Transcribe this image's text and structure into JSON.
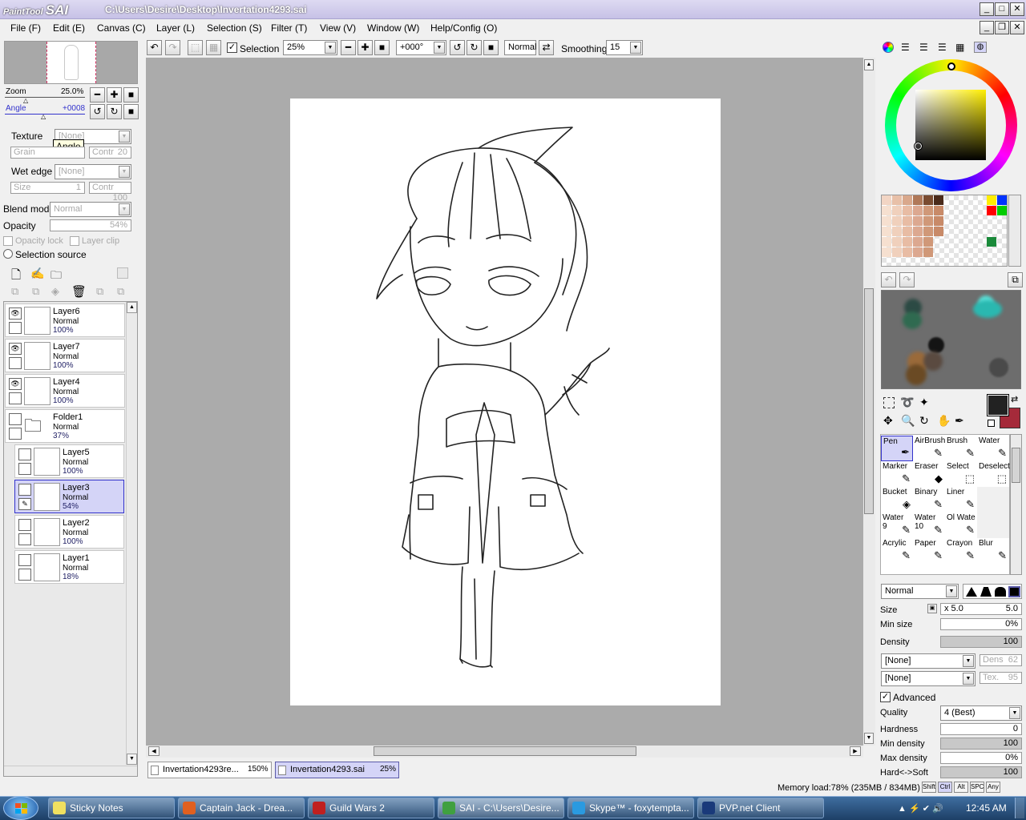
{
  "app": {
    "logo_small": "PaintTool",
    "logo_big": "SAI",
    "title": "C:\\Users\\Desire\\Desktop\\Invertation4293.sai"
  },
  "menu": [
    "File (F)",
    "Edit (E)",
    "Canvas (C)",
    "Layer (L)",
    "Selection (S)",
    "Filter (T)",
    "View (V)",
    "Window (W)",
    "Help/Config (O)"
  ],
  "toolbar": {
    "selection_label": "Selection",
    "zoom_value": "25%",
    "rotation_value": "+000°",
    "blend_value": "Normal",
    "smoothing_label": "Smoothing",
    "smoothing_value": "15"
  },
  "navigator": {
    "zoom_label": "Zoom",
    "zoom_value": "25.0%",
    "angle_label": "Angle",
    "angle_value": "+0008",
    "tooltip": "Angle"
  },
  "texture": {
    "texture_label": "Texture",
    "texture_value": "[None]",
    "grain_label": "Grain",
    "contr_label": "Contr",
    "contr_value": "20",
    "wet_edge_label": "Wet edge",
    "wet_edge_value": "[None]",
    "size_label": "Size",
    "size_value": "1",
    "contr2_label": "Contr",
    "contr2_value": "100"
  },
  "layer_props": {
    "blend_label": "Blend mode",
    "blend_value": "Normal",
    "opacity_label": "Opacity",
    "opacity_value": "54%",
    "opacity_lock": "Opacity lock",
    "layer_clip": "Layer clip",
    "selection_source": "Selection source"
  },
  "layers": [
    {
      "name": "Layer6",
      "mode": "Normal",
      "opacity": "100%",
      "visible": true,
      "indent": false,
      "selected": false
    },
    {
      "name": "Layer7",
      "mode": "Normal",
      "opacity": "100%",
      "visible": true,
      "indent": false,
      "selected": false
    },
    {
      "name": "Layer4",
      "mode": "Normal",
      "opacity": "100%",
      "visible": true,
      "indent": false,
      "selected": false
    },
    {
      "name": "Folder1",
      "mode": "Normal",
      "opacity": "37%",
      "visible": false,
      "indent": false,
      "selected": false
    },
    {
      "name": "Layer5",
      "mode": "Normal",
      "opacity": "100%",
      "visible": false,
      "indent": true,
      "selected": false
    },
    {
      "name": "Layer3",
      "mode": "Normal",
      "opacity": "54%",
      "visible": false,
      "indent": true,
      "selected": true
    },
    {
      "name": "Layer2",
      "mode": "Normal",
      "opacity": "100%",
      "visible": false,
      "indent": true,
      "selected": false
    },
    {
      "name": "Layer1",
      "mode": "Normal",
      "opacity": "18%",
      "visible": false,
      "indent": true,
      "selected": false
    }
  ],
  "doc_tabs": [
    {
      "name": "Invertation4293re...",
      "zoom": "150%",
      "active": false
    },
    {
      "name": "Invertation4293.sai",
      "zoom": "25%",
      "active": true
    }
  ],
  "tools": [
    {
      "label": "Pen",
      "icon": "pen-icon",
      "glyph": "✒"
    },
    {
      "label": "AirBrush",
      "icon": "airbrush-icon",
      "glyph": "✎"
    },
    {
      "label": "Brush",
      "icon": "brush-icon",
      "glyph": "✎"
    },
    {
      "label": "Water",
      "icon": "water-icon",
      "glyph": "✎"
    },
    {
      "label": "Marker",
      "icon": "marker-icon",
      "glyph": "✎"
    },
    {
      "label": "Eraser",
      "icon": "eraser-icon",
      "glyph": "◆"
    },
    {
      "label": "Select",
      "icon": "select-icon",
      "glyph": "⬚"
    },
    {
      "label": "Deselect",
      "icon": "deselect-icon",
      "glyph": "⬚"
    },
    {
      "label": "Bucket",
      "icon": "bucket-icon",
      "glyph": "◈"
    },
    {
      "label": "Binary",
      "icon": "binary-icon",
      "glyph": "✎"
    },
    {
      "label": "Liner",
      "icon": "liner-icon",
      "glyph": "✎"
    },
    {
      "label": "",
      "icon": "empty-slot-icon",
      "glyph": ""
    },
    {
      "label": "Water\n9",
      "icon": "water9-icon",
      "glyph": "✎"
    },
    {
      "label": "Water\n10",
      "icon": "water10-icon",
      "glyph": "✎"
    },
    {
      "label": "Ol Wate",
      "icon": "oil-water-icon",
      "glyph": "✎"
    },
    {
      "label": "",
      "icon": "empty-slot-icon",
      "glyph": ""
    },
    {
      "label": "Acrylic",
      "icon": "acrylic-icon",
      "glyph": "✎"
    },
    {
      "label": "Paper",
      "icon": "paper-icon",
      "glyph": "✎"
    },
    {
      "label": "Crayon",
      "icon": "crayon-icon",
      "glyph": "✎"
    },
    {
      "label": "Blur",
      "icon": "blur-icon",
      "glyph": "✎"
    }
  ],
  "brush": {
    "mode_value": "Normal",
    "size_label": "Size",
    "size_mult": "x 5.0",
    "size_value": "5.0",
    "min_size_label": "Min size",
    "min_size_value": "0%",
    "density_label": "Density",
    "density_value": "100",
    "density_level": 1.0,
    "tex1_value": "[None]",
    "dens_label": "Dens",
    "dens_value": "62",
    "tex2_value": "[None]",
    "tex_label": "Tex.",
    "tex_value": "95",
    "advanced_label": "Advanced",
    "quality_label": "Quality",
    "quality_value": "4 (Best)",
    "hardness_label": "Hardness",
    "hardness_value": "0",
    "hardness_level": 0.0,
    "min_density_label": "Min density",
    "min_density_value": "100",
    "min_density_level": 1.0,
    "max_density_label": "Max density",
    "max_density_value": "0%",
    "max_density_level": 0.0,
    "hard_soft_label": "Hard<->Soft",
    "hard_soft_value": "100",
    "hard_soft_level": 1.0
  },
  "status": {
    "memory": "Memory load:78% (235MB / 834MB)",
    "keys": [
      "Shift",
      "Ctrl",
      "Alt",
      "SPC",
      "Any"
    ]
  },
  "colors": {
    "primary": "#222222",
    "secondary": "#a52a3a",
    "selected_layer_bg": "#d4d4f7",
    "accent": "#3333cc"
  },
  "swatches_row1": [
    "#f2d5c4",
    "#e8c0a8",
    "#d9a88c",
    "#b07858",
    "#7a4b30",
    "#4a2a1a"
  ],
  "taskbar": {
    "items": [
      "Sticky Notes",
      "Captain Jack - Drea...",
      "Guild Wars 2",
      "SAI - C:\\Users\\Desire...",
      "Skype™ - foxytempta...",
      "PVP.net Client"
    ],
    "clock": "12:45 AM"
  }
}
